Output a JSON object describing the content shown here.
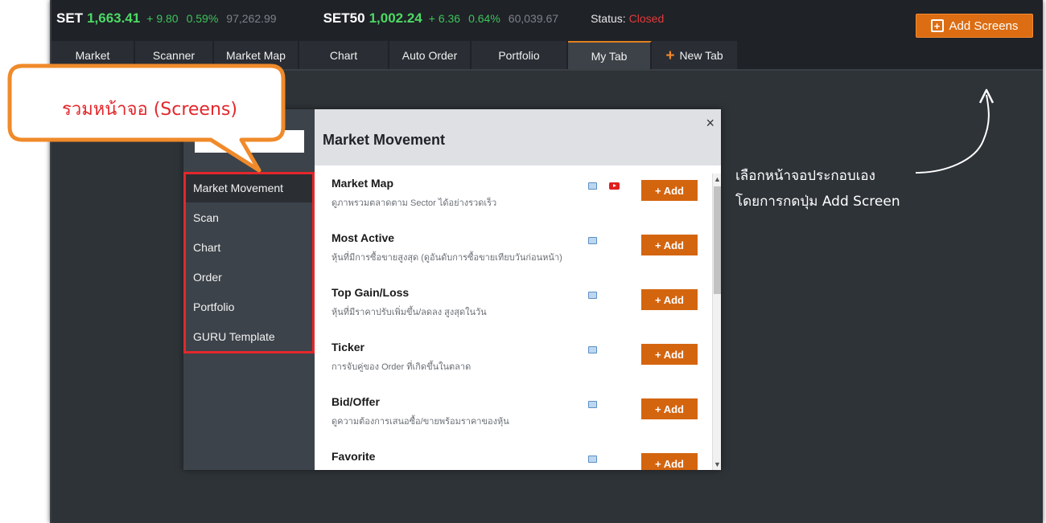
{
  "ticker": {
    "set_name": "SET",
    "set_value": "1,663.41",
    "set_change": "+ 9.80",
    "set_pct": "0.59%",
    "set_volume": "97,262.99",
    "set50_name": "SET50",
    "set50_value": "1,002.24",
    "set50_change": "+ 6.36",
    "set50_pct": "0.64%",
    "set50_volume": "60,039.67",
    "status_label": "Status:",
    "status_value": "Closed"
  },
  "header": {
    "add_screens_label": "Add Screens",
    "add_screens_icon": "plus-box-icon"
  },
  "tabs": [
    {
      "label": "Market"
    },
    {
      "label": "Scanner"
    },
    {
      "label": "Market Map"
    },
    {
      "label": "Chart"
    },
    {
      "label": "Auto Order"
    },
    {
      "label": "Portfolio"
    },
    {
      "label": "My Tab",
      "active": true
    },
    {
      "label": "New Tab",
      "icon": "plus-icon"
    }
  ],
  "modal": {
    "title": "Market Movement",
    "close_glyph": "×",
    "categories": [
      {
        "label": "Market Movement",
        "active": true
      },
      {
        "label": "Scan"
      },
      {
        "label": "Chart"
      },
      {
        "label": "Order"
      },
      {
        "label": "Portfolio"
      },
      {
        "label": "GURU Template"
      }
    ],
    "screens": [
      {
        "title": "Market Map",
        "desc": "ดูภาพรวมตลาดตาม Sector ได้อย่างรวดเร็ว",
        "has_video": true,
        "add_label": "+ Add"
      },
      {
        "title": "Most Active",
        "desc": "หุ้นที่มีการซื้อขายสูงสุด (ดูอันดับการซื้อขายเทียบวันก่อนหน้า)",
        "has_video": false,
        "add_label": "+ Add"
      },
      {
        "title": "Top Gain/Loss",
        "desc": "หุ้นที่มีราคาปรับเพิ่มขึ้น/ลดลง สูงสุดในวัน",
        "has_video": false,
        "add_label": "+ Add"
      },
      {
        "title": "Ticker",
        "desc": "การจับคู่ของ Order ที่เกิดขึ้นในตลาด",
        "has_video": false,
        "add_label": "+ Add"
      },
      {
        "title": "Bid/Offer",
        "desc": "ดูความต้องการเสนอซื้อ/ขายพร้อมราคาของหุ้น",
        "has_video": false,
        "add_label": "+ Add"
      },
      {
        "title": "Favorite",
        "desc": "",
        "has_video": false,
        "add_label": "+ Add"
      }
    ]
  },
  "annotations": {
    "callout": "รวมหน้าจอ (Screens)",
    "note_line1": "เลือกหน้าจอประกอบเอง",
    "note_line2": "โดยการกดปุ่ม Add Screen"
  },
  "colors": {
    "accent": "#dc6d12",
    "up": "#4cd964",
    "status_closed": "#e23b3b",
    "highlight": "#e3272b"
  }
}
